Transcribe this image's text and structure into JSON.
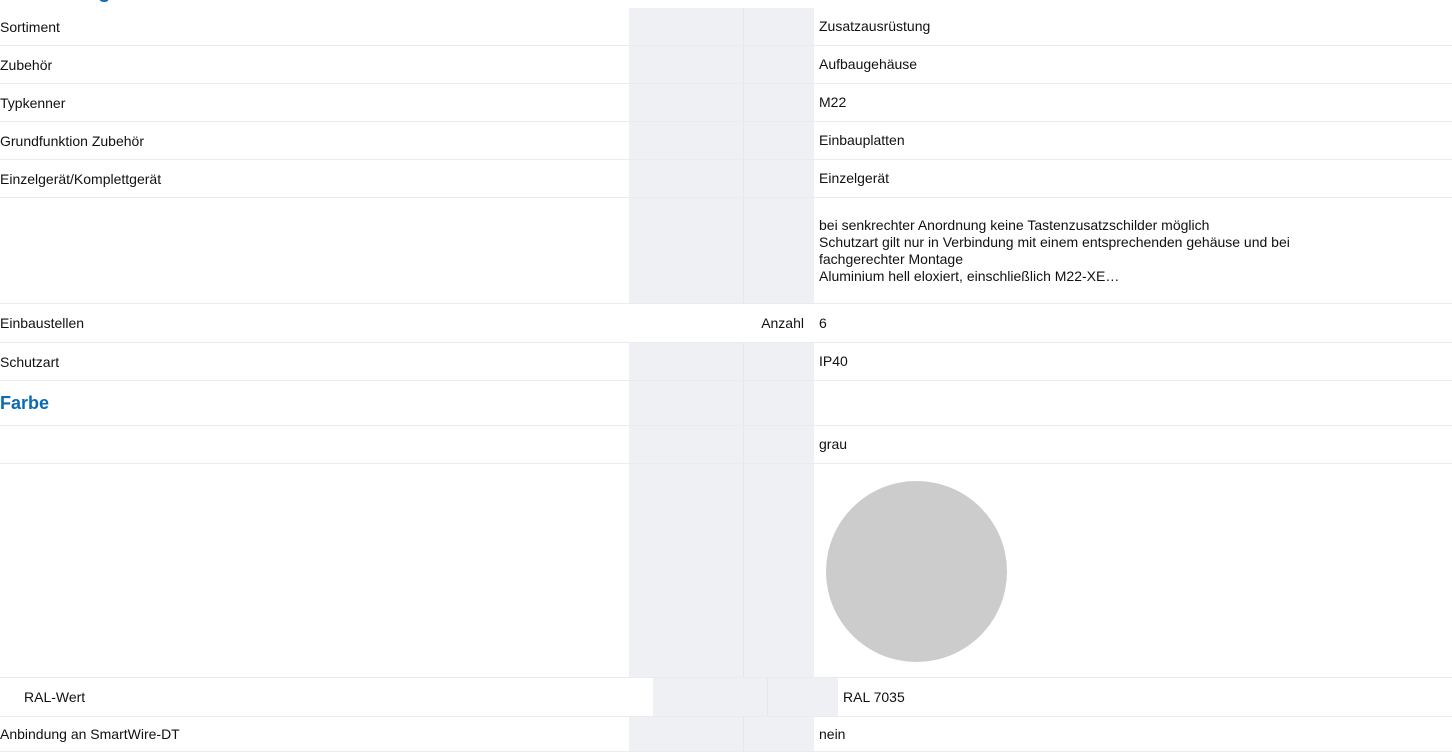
{
  "rows": [
    {
      "label": "Sortiment",
      "unit": "",
      "value": "Zusatzausrüstung"
    },
    {
      "label": "Zubehör",
      "unit": "",
      "value": "Aufbaugehäuse"
    },
    {
      "label": "Typkenner",
      "unit": "",
      "value": "M22"
    },
    {
      "label": "Grundfunktion Zubehör",
      "unit": "",
      "value": "Einbauplatten"
    },
    {
      "label": "Einzelgerät/Komplettgerät",
      "unit": "",
      "value": "Einzelgerät"
    },
    {
      "label": "",
      "unit": "",
      "value_lines": [
        "bei senkrechter Anordnung keine Tastenzusatzschilder möglich",
        "Schutzart gilt nur in Verbindung mit einem entsprechenden gehäuse und bei",
        "fachgerechter Montage",
        "Aluminium hell eloxiert, einschließlich M22-XE…"
      ]
    },
    {
      "label": "Einbaustellen",
      "unit": "Anzahl",
      "value": "6"
    },
    {
      "label": "Schutzart",
      "unit": "",
      "value": "IP40"
    }
  ],
  "farbe": {
    "title": "Farbe",
    "color_name": "grau",
    "swatch_color": "#cccccc",
    "ral_label": "RAL-Wert",
    "ral_value": "RAL 7035"
  },
  "smartwire": {
    "label": "Anbindung an SmartWire-DT",
    "value": "nein"
  },
  "colors": {
    "accent": "#0a6ab6",
    "unit_col_bg": "#eef0f4",
    "row_border": "#e9ebee"
  }
}
